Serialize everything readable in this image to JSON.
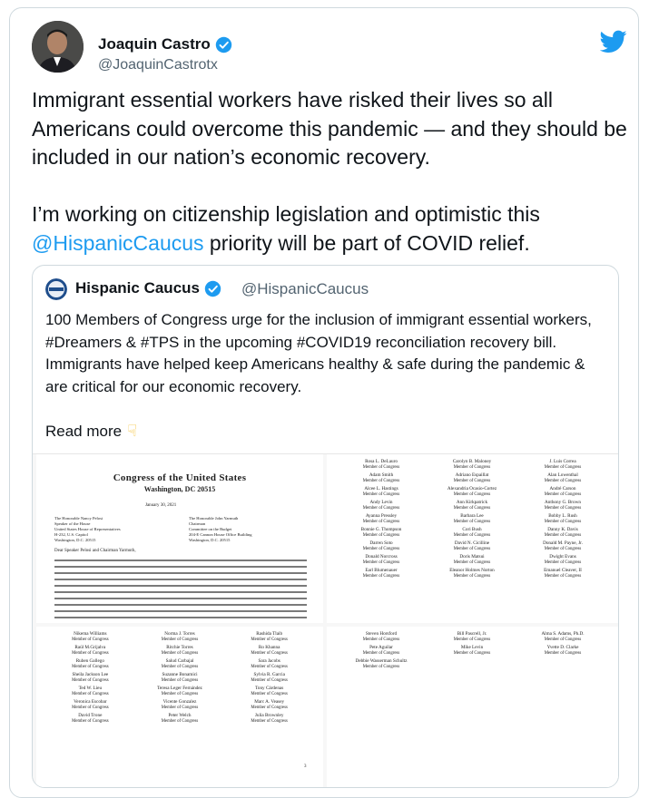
{
  "tweet": {
    "author_name": "Joaquin Castro",
    "author_handle": "@JoaquinCastrotx",
    "text_part1": "Immigrant essential workers have risked their lives so all Americans could overcome this pandemic — and they should be included in our nation’s economic recovery.\n\nI’m working on citizenship legislation and optimistic this ",
    "mention": "@HispanicCaucus",
    "text_part2": " priority will be part of COVID relief."
  },
  "quote": {
    "author_name": "Hispanic Caucus",
    "author_handle": "@HispanicCaucus",
    "text": "100 Members of Congress urge for the inclusion of immigrant essential workers, #Dreamers & #TPS in the upcoming #COVID19 reconciliation recovery bill. Immigrants have helped keep Americans healthy & safe during the pandemic & are critical for our economic recovery.",
    "read_more": "Read more"
  },
  "letter": {
    "title": "Congress of the United States",
    "city": "Washington, DC 20515",
    "date": "January 30, 2021",
    "addressee_left": "The Honorable Nancy Pelosi\nSpeaker of the House\nUnited States House of Representatives\nH-232, U.S. Capitol\nWashington, D.C. 20515",
    "addressee_right": "The Honorable John Yarmuth\nChairman\nCommittee on the Budget\n204-E Cannon House Office Building\nWashington, D.C. 20515",
    "salutation": "Dear Speaker Pelosi and Chairman Yarmuth,",
    "page_number": "3",
    "member_role": "Member of Congress"
  },
  "signers": {
    "page2": [
      "Rosa L. DeLauro",
      "Carolyn B. Maloney",
      "J. Luis Correa",
      "Adam Smith",
      "Adriano Espaillat",
      "Alan Lowenthal",
      "Alcee L. Hastings",
      "Alexandria Ocasio-Cortez",
      "André Carson",
      "Andy Levin",
      "Ann Kirkpatrick",
      "Anthony G. Brown",
      "Ayanna Pressley",
      "Barbara Lee",
      "Bobby L. Rush",
      "Bonnie G. Thompson",
      "Cori Bush",
      "Danny K. Davis",
      "Darren Soto",
      "David N. Cicilline",
      "Donald M. Payne, Jr.",
      "Donald Norcross",
      "Doris Matsui",
      "Dwight Evans",
      "Earl Blumenauer",
      "Eleanor Holmes Norton",
      "Emanuel Cleaver, II"
    ],
    "page3": [
      "Nikema Williams",
      "Norma J. Torres",
      "Rashida Tlaib",
      "Raúl M.Grijalva",
      "Ritchie Torres",
      "Ro Khanna",
      "Ruben Gallego",
      "Salud Carbajal",
      "Sara Jacobs",
      "Sheila Jackson Lee",
      "Suzanne Bonamici",
      "Sylvia R. Garcia",
      "Ted W. Lieu",
      "Teresa Leger Fernández",
      "Tony Cárdenas",
      "Veronica Escobar",
      "Vicente Gonzalez",
      "Marc A. Veasey",
      "David Trone",
      "Peter Welch",
      "Julia Brownley"
    ],
    "page4": [
      "Steven Horsford",
      "Bill Pascrell, Jr.",
      "Alma S. Adams, Ph.D.",
      "Pete Aguilar",
      "Mike Levin",
      "Yvette D. Clarke",
      "Debbie Wasserman Schultz"
    ]
  },
  "colors": {
    "accent": "#1d9bf0",
    "border": "#cfd9de",
    "secondary_text": "#536471"
  }
}
